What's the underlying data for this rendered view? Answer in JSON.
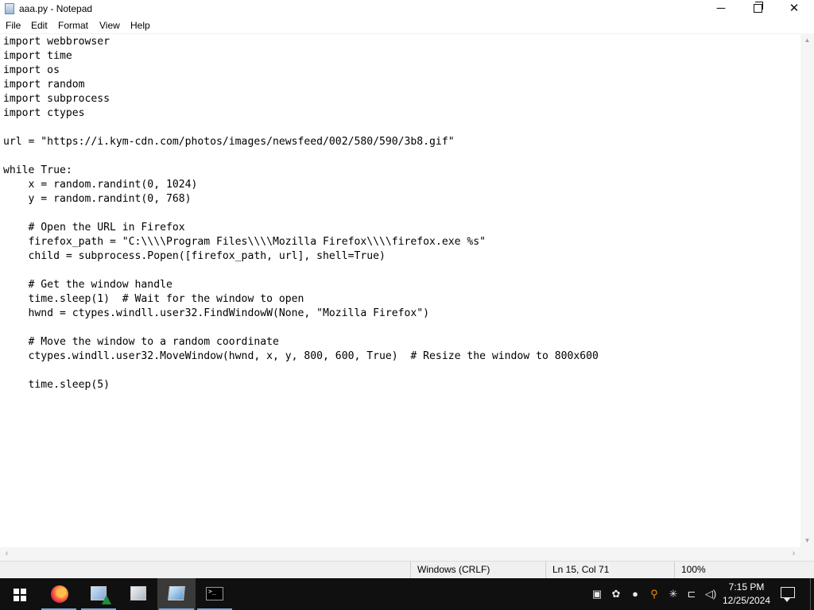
{
  "window": {
    "title": "aaa.py - Notepad",
    "controls": {
      "minimize": "─",
      "close": "✕"
    }
  },
  "menu": [
    "File",
    "Edit",
    "Format",
    "View",
    "Help"
  ],
  "editor": {
    "content": "import webbrowser\nimport time\nimport os\nimport random\nimport subprocess\nimport ctypes\n\nurl = \"https://i.kym-cdn.com/photos/images/newsfeed/002/580/590/3b8.gif\"\n\nwhile True:\n    x = random.randint(0, 1024)\n    y = random.randint(0, 768)\n\n    # Open the URL in Firefox\n    firefox_path = \"C:\\\\\\\\Program Files\\\\\\\\Mozilla Firefox\\\\\\\\firefox.exe %s\"\n    child = subprocess.Popen([firefox_path, url], shell=True)\n\n    # Get the window handle\n    time.sleep(1)  # Wait for the window to open\n    hwnd = ctypes.windll.user32.FindWindowW(None, \"Mozilla Firefox\")\n\n    # Move the window to a random coordinate\n    ctypes.windll.user32.MoveWindow(hwnd, x, y, 800, 600, True)  # Resize the window to 800x600\n\n    time.sleep(5)"
  },
  "statusbar": {
    "line_ending": "Windows (CRLF)",
    "position": "Ln 15, Col 71",
    "zoom": "100%"
  },
  "taskbar": {
    "apps": [
      "start-icon",
      "firefox-icon",
      "notepad-icon",
      "notepad-icon",
      "notepad-icon",
      "terminal-icon"
    ],
    "tray_icons": [
      "network-computer-icon",
      "settings-gear-icon",
      "droplet-icon",
      "search-icon",
      "sparkle-icon",
      "network-icon",
      "volume-icon"
    ],
    "time": "7:15 PM",
    "date": "12/25/2024",
    "cmd_glyph": ">_"
  }
}
